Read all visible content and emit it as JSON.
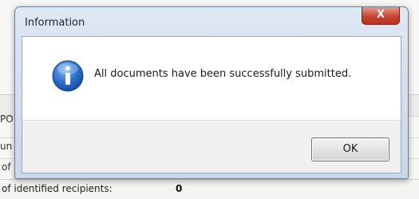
{
  "dialog": {
    "title": "Information",
    "close_label": "X",
    "icon": "info-icon",
    "message": "All documents have been successfully submitted.",
    "ok_label": "OK"
  },
  "background": {
    "fragments": [
      "PO",
      "un",
      "of"
    ],
    "footer_label": "of identified recipients:",
    "footer_value": "0"
  },
  "colors": {
    "close_button": "#c64531",
    "info_icon": "#1f5fb8",
    "title_bar": "#dfe8f3"
  }
}
